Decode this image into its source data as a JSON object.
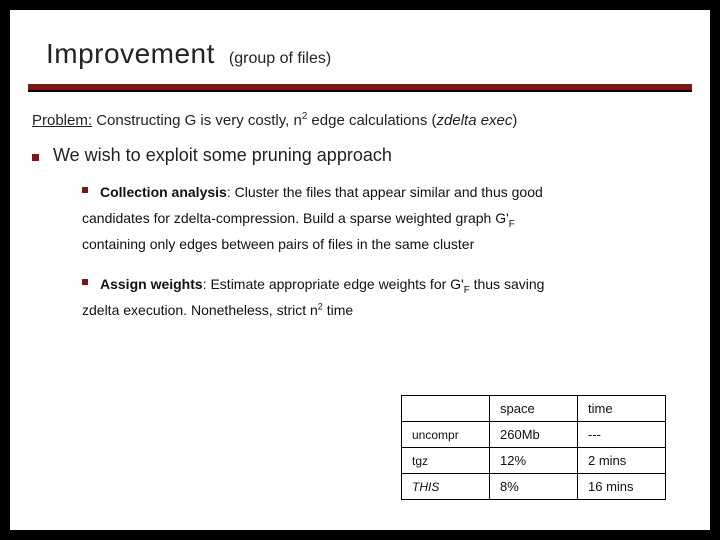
{
  "title": {
    "main": "Improvement",
    "sub": "(group of files)"
  },
  "problem": {
    "label": "Problem:",
    "before_sup": " Constructing G is very costly, n",
    "sup": "2",
    "after_sup": " edge calculations (",
    "italic": "zdelta exec",
    "close": ")"
  },
  "bullet1": "We wish to exploit some pruning approach",
  "sub1": {
    "lead": "Collection analysis",
    "rest1": ": Cluster the files that appear similar and thus good",
    "line2a": "candidates for zdelta-compression. Build a sparse weighted graph G'",
    "line2_sub": "F",
    "line3": "containing only edges between pairs of files in the same cluster"
  },
  "sub2": {
    "lead": "Assign weights",
    "rest1a": ": Estimate appropriate edge weights for G'",
    "rest1_sub": "F",
    "rest1b": " thus saving",
    "line2a": "zdelta execution. Nonetheless, strict n",
    "line2_sup": "2",
    "line2b": " time"
  },
  "chart_data": {
    "type": "table",
    "columns": [
      "",
      "space",
      "time"
    ],
    "rows": [
      {
        "label": "uncompr",
        "space": "260Mb",
        "time": "---"
      },
      {
        "label": "tgz",
        "space": "12%",
        "time": "2 mins"
      },
      {
        "label": "THIS",
        "space": "8%",
        "time": "16 mins"
      }
    ]
  }
}
